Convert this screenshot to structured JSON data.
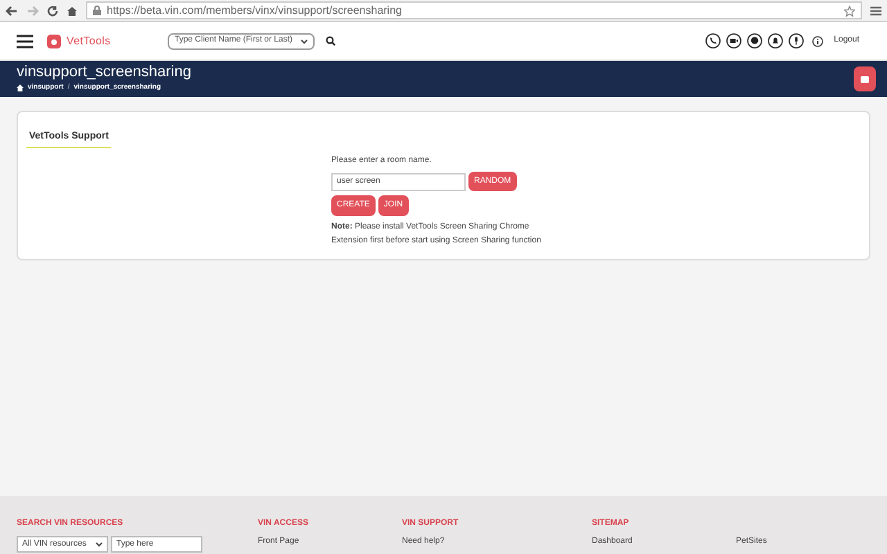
{
  "browser": {
    "url": "https://beta.vin.com/members/vinx/vinsupport/screensharing"
  },
  "header": {
    "logo": "VetTools",
    "client_search": {
      "placeholder": "Type Client Name (First or Last)"
    },
    "logout": "Logout"
  },
  "banner": {
    "title": "vinsupport_screensharing",
    "breadcrumb": [
      "vinsupport",
      "vinsupport_screensharing"
    ],
    "breadcrumb_separator": "/"
  },
  "panel": {
    "title": "VetTools Support",
    "prompt": "Please enter a room name.",
    "room_field": {
      "value": "user screen"
    },
    "buttons": [
      "RANDOM",
      "CREATE",
      "JOIN"
    ],
    "note_label": "Note:",
    "note": "Please install VetTools Screen Sharing Chrome Extension first before start using Screen Sharing function"
  },
  "footer": {
    "columns": [
      {
        "heading": "SEARCH VIN RESOURCES",
        "kind": "search",
        "select": "All VIN resources",
        "placeholder": "Type here"
      },
      {
        "heading": "VIN ACCESS",
        "kind": "links",
        "links": [
          "Front Page"
        ]
      },
      {
        "heading": "VIN SUPPORT",
        "kind": "links",
        "links": [
          "Need help?"
        ]
      },
      {
        "heading": "SITEMAP",
        "kind": "links",
        "links": [
          "Dashboard"
        ]
      },
      {
        "kind": "links",
        "links": [
          "PetSites"
        ]
      }
    ]
  }
}
